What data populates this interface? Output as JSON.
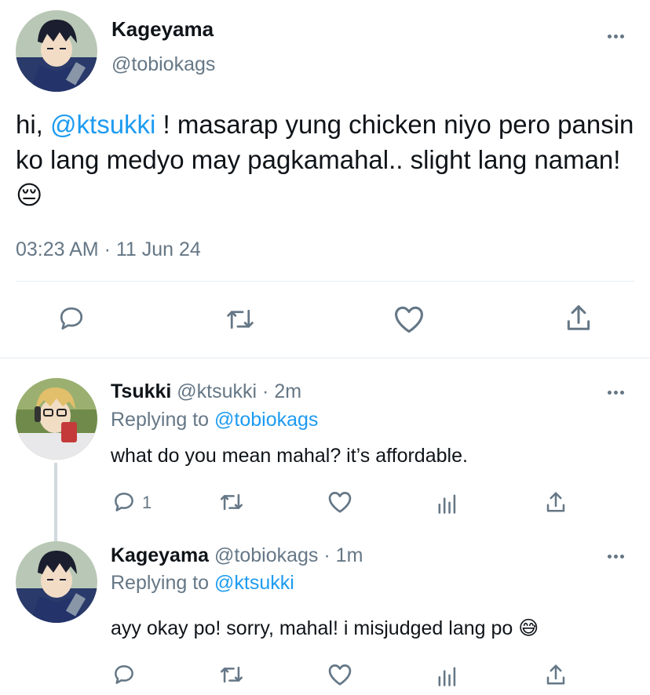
{
  "main_tweet": {
    "display_name": "Kageyama",
    "handle": "@tobiokags",
    "text_parts": {
      "pre": "hi, ",
      "mention": "@ktsukki",
      "post": " ! masarap yung chicken niyo pero pansin ko lang medyo may pagkamahal.. slight lang naman! ",
      "emoji": "😔"
    },
    "timestamp": "03:23 AM · 11 Jun 24",
    "actions": [
      "reply-icon",
      "retweet-icon",
      "like-icon",
      "share-icon"
    ]
  },
  "replies": [
    {
      "display_name": "Tsukki",
      "handle": "@ktsukki",
      "time": "· 2m",
      "replying_prefix": "Replying to ",
      "replying_to": "@tobiokags",
      "text": "what do you mean mahal? it’s affordable.",
      "emoji": "",
      "reply_count": "1"
    },
    {
      "display_name": "Kageyama",
      "handle": "@tobiokags",
      "time": "· 1m",
      "replying_prefix": "Replying to ",
      "replying_to": "@ktsukki",
      "text": "ayy okay po! sorry, mahal! i misjudged lang po ",
      "emoji": "😅",
      "reply_count": ""
    }
  ],
  "colors": {
    "link": "#1d9bf0",
    "secondary_text": "#657786",
    "divider": "#e6ecf0"
  }
}
